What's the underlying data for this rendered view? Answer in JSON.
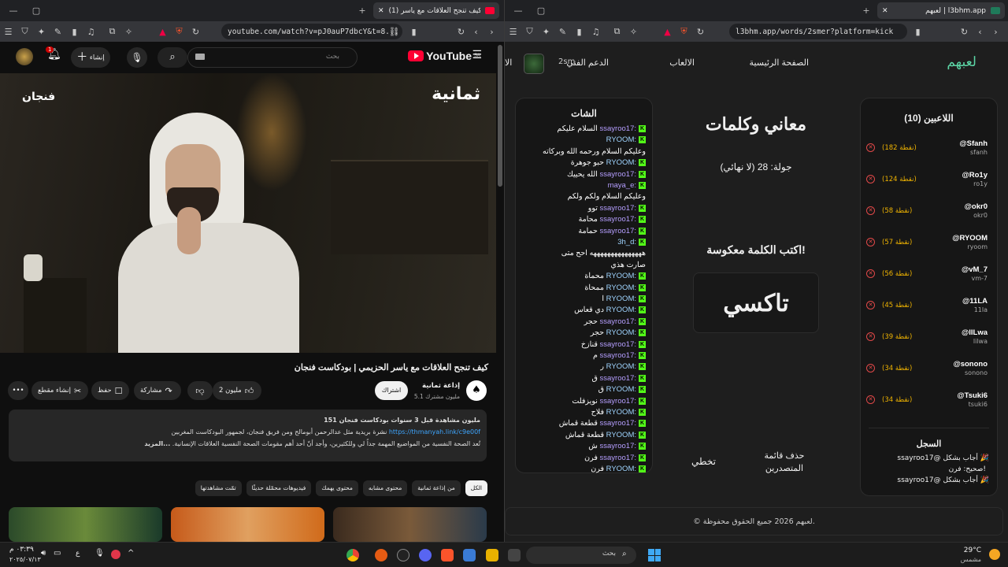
{
  "left_browser": {
    "tab_title": "(1) كيف تنجح العلاقات مع ياسر",
    "url": "youtube.com/watch?v=pJ0auP7dbcY&t=8...",
    "youtube": {
      "logo_text": "YouTube",
      "logo_region": "SA",
      "search_placeholder": "بحث",
      "create_label": "إنشاء",
      "notif_count": "1",
      "video_overlay_right": "ثمانية",
      "video_overlay_left": "فنجان",
      "video_title": "كيف تنجح العلاقات مع ياسر الحزيمي | بودكاست فنجان",
      "channel_name": "إذاعة ثمانية",
      "subscribers": "5.1 مليون مشترك",
      "subscribe_label": "اشتراك",
      "likes": "2 مليون",
      "share_label": "مشاركة",
      "save_label": "حفظ",
      "clip_label": "إنشاء مقطع",
      "desc_stats": "151 مليون مشاهدة  قبل 3 سنوات  بودكاست فنجان",
      "desc_line2": "نشرة بريدية مثل عدالرحمن أبومالح ومن فريق فنجان، لجمهور البودكاست المغربين",
      "desc_link": "https://thmanyah.link/c9e00f",
      "desc_line3": "تُعد الصحة النفسية من المواضيع المهمة جداً لي وللكثيرين، وأجد أنّ أحد أهم مقومات الصحة النفسية العلاقات الإنسانية.",
      "desc_more": "...المزيد",
      "chips": [
        "الكل",
        "من إذاعة ثمانية",
        "محتوى مشابه",
        "محتوى يهمك",
        "فيديوهات محمّلة حديثًا",
        "تمّت مشاهدتها"
      ]
    }
  },
  "right_browser": {
    "tab_title": "لعبهم | l3bhm.app",
    "url": "l3bhm.app/words/2smer?platform=kick",
    "site": {
      "logo": "لعبهم",
      "nav": [
        "الصفحة الرئيسية",
        "الالعاب",
        "الدعم الفني",
        "الا"
      ],
      "avatar_label": "2sm",
      "players_title": "اللاعبين (10)",
      "players": [
        {
          "name": "@Sfanh",
          "handle": "sfanh",
          "score": "(182 نقطة)"
        },
        {
          "name": "@Ro1y",
          "handle": "ro1y",
          "score": "(124 نقطة)"
        },
        {
          "name": "@okr0",
          "handle": "okr0",
          "score": "(58 نقطة)"
        },
        {
          "name": "@RYOOM",
          "handle": "ryoom",
          "score": "(57 نقطة)"
        },
        {
          "name": "@vM_7",
          "handle": "vm-7",
          "score": "(56 نقطة)"
        },
        {
          "name": "@11LA",
          "handle": "11la",
          "score": "(45 نقطة)"
        },
        {
          "name": "@lILwa",
          "handle": "lilwa",
          "score": "(39 نقطة)"
        },
        {
          "name": "@sonono",
          "handle": "sonono",
          "score": "(34 نقطة)"
        },
        {
          "name": "@Tsuki6",
          "handle": "tsuki6",
          "score": "(34 نقطة)"
        }
      ],
      "log_title": "السجل",
      "log": [
        "ssayroo17@ أجاب بشكل",
        "صحيح: فرن!",
        "ssayroo17@ أجاب بشكل"
      ],
      "game_title": "معاني وكلمات",
      "round": "جولة: 28 (لا نهائي)",
      "prompt": "اكتب الكلمة معكوسة!",
      "word": "تاكسي",
      "btn_delete": "حذف قائمة المتصدرين",
      "btn_skip": "تخطي",
      "chat_title": "الشات",
      "chat": [
        {
          "u": "ssayroo17:",
          "m": "السلام عليكم"
        },
        {
          "u": "RYOOM:",
          "m": ""
        },
        {
          "u": "",
          "m": "وعليكم السلام ورحمه الله وبركاته"
        },
        {
          "u": "RYOOM:",
          "m": "حبو جوهرة"
        },
        {
          "u": "ssayroo17:",
          "m": "الله يحييك"
        },
        {
          "u": "maya_e:",
          "m": ""
        },
        {
          "u": "",
          "m": "وعليكم السلام ولكم ولكم"
        },
        {
          "u": "ssayroo17:",
          "m": "توو"
        },
        {
          "u": "ssayroo17:",
          "m": "محامة"
        },
        {
          "u": "ssayroo17:",
          "m": "حمامة"
        },
        {
          "u": "3h_d:",
          "m": ""
        },
        {
          "u": "",
          "m": "هههههههههههههههه احح متى"
        },
        {
          "u": "",
          "m": "صارت هذي"
        },
        {
          "u": "RYOOM:",
          "m": "محماة"
        },
        {
          "u": "RYOOM:",
          "m": "ممحاة"
        },
        {
          "u": "RYOOM:",
          "m": "ا"
        },
        {
          "u": "RYOOM:",
          "m": "دي قعاس"
        },
        {
          "u": "ssayroo17:",
          "m": "حجر"
        },
        {
          "u": "RYOOM:",
          "m": "حجر"
        },
        {
          "u": "ssayroo17:",
          "m": "قنازخ"
        },
        {
          "u": "ssayroo17:",
          "m": "م"
        },
        {
          "u": "RYOOM:",
          "m": "ر"
        },
        {
          "u": "ssayroo17:",
          "m": "ق"
        },
        {
          "u": "RYOOM:",
          "m": "ق"
        },
        {
          "u": "ssayroo17:",
          "m": "نويزفلت"
        },
        {
          "u": "RYOOM:",
          "m": "فلاح"
        },
        {
          "u": "ssayroo17:",
          "m": "قطعة قماش"
        },
        {
          "u": "RYOOM:",
          "m": "قطعة قماش"
        },
        {
          "u": "ssayroo17:",
          "m": "ش"
        },
        {
          "u": "ssayroo17:",
          "m": "فرن"
        },
        {
          "u": "RYOOM:",
          "m": "فرن"
        }
      ],
      "footer": "© لعبهم 2026 جميع الحقوق محفوظة."
    }
  },
  "taskbar": {
    "search_placeholder": "بحث",
    "weather_temp": "29°C",
    "weather_desc": "مشمس",
    "time": "٠٣:٣٩ م",
    "date": "٢٠٢٥/٠٧/١٣",
    "lang": "ع"
  }
}
